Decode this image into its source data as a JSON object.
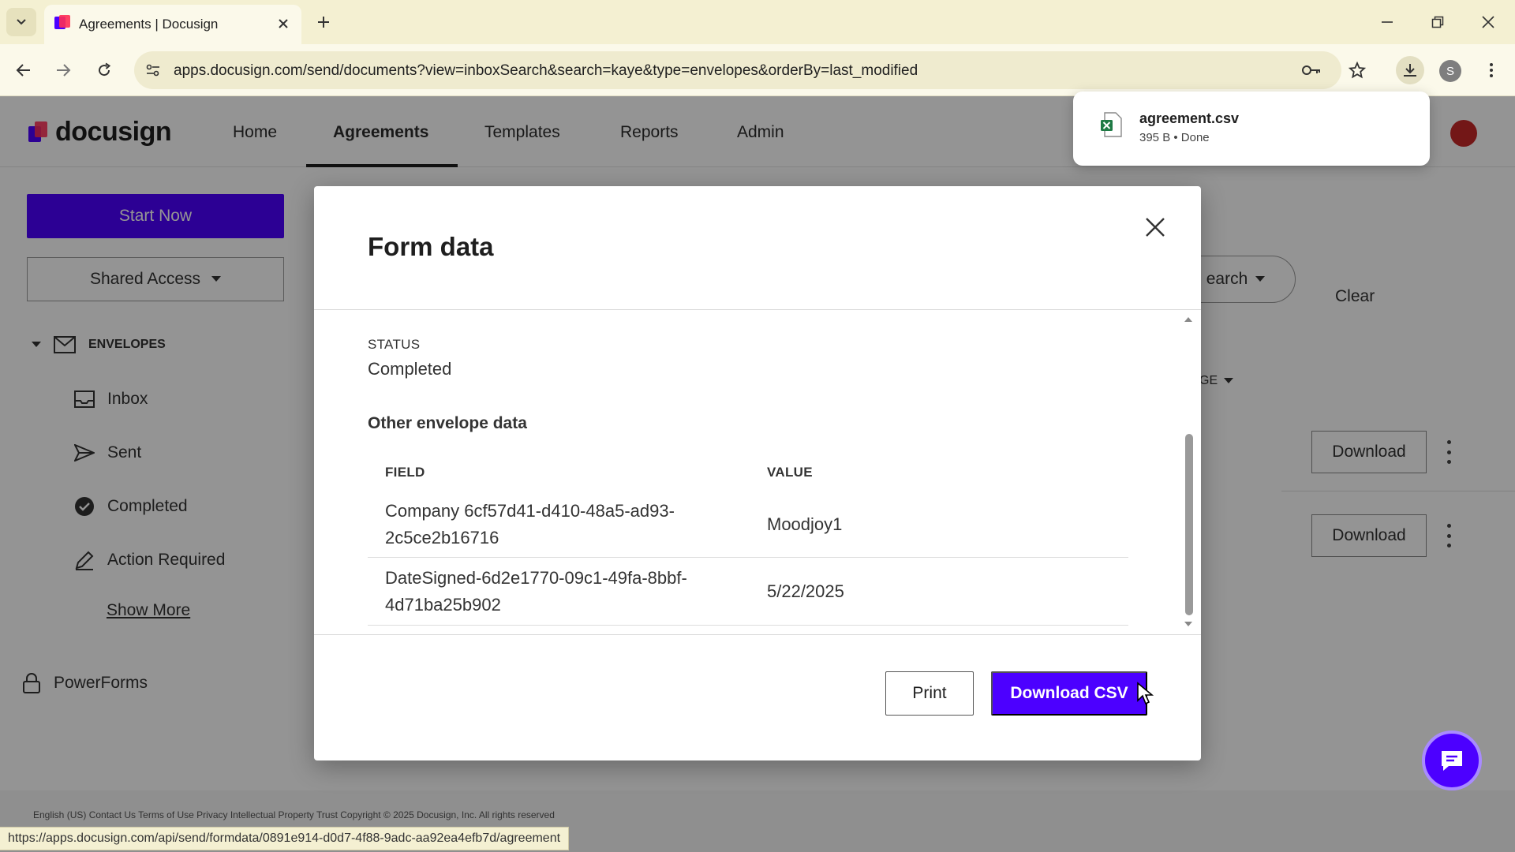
{
  "browser": {
    "tab_title": "Agreements | Docusign",
    "url": "apps.docusign.com/send/documents?view=inboxSearch&search=kaye&type=envelopes&orderBy=last_modified",
    "profile_initial": "S",
    "status_url": "https://apps.docusign.com/api/send/formdata/0891e914-d0d7-4f88-9adc-aa92ea4efb7d/agreement"
  },
  "download": {
    "filename": "agreement.csv",
    "meta": "395 B • Done"
  },
  "app": {
    "logo": "docusign",
    "nav": [
      "Home",
      "Agreements",
      "Templates",
      "Reports",
      "Admin"
    ],
    "start_now": "Start Now",
    "shared_access": "Shared Access",
    "envelopes_heading": "ENVELOPES",
    "sidebar": [
      "Inbox",
      "Sent",
      "Completed",
      "Action Required"
    ],
    "show_more": "Show More",
    "powerforms": "PowerForms",
    "search_fragment": "earch",
    "clear": "Clear",
    "column_fragment": "GE",
    "download_label": "Download",
    "footer": "English (US)    Contact Us    Terms of Use    Privacy    Intellectual Property    Trust    Copyright © 2025 Docusign, Inc. All rights reserved"
  },
  "modal": {
    "title": "Form data",
    "status_label": "STATUS",
    "status_value": "Completed",
    "section_title": "Other envelope data",
    "col_field": "FIELD",
    "col_value": "VALUE",
    "rows": [
      {
        "field": "Company 6cf57d41-d410-48a5-ad93-2c5ce2b16716",
        "value": "Moodjoy1"
      },
      {
        "field": "DateSigned-6d2e1770-09c1-49fa-8bbf-4d71ba25b902",
        "value": "5/22/2025"
      }
    ],
    "print": "Print",
    "download_csv": "Download CSV"
  },
  "colors": {
    "brand": "#4c00ff",
    "chrome": "#f4f0d2"
  }
}
